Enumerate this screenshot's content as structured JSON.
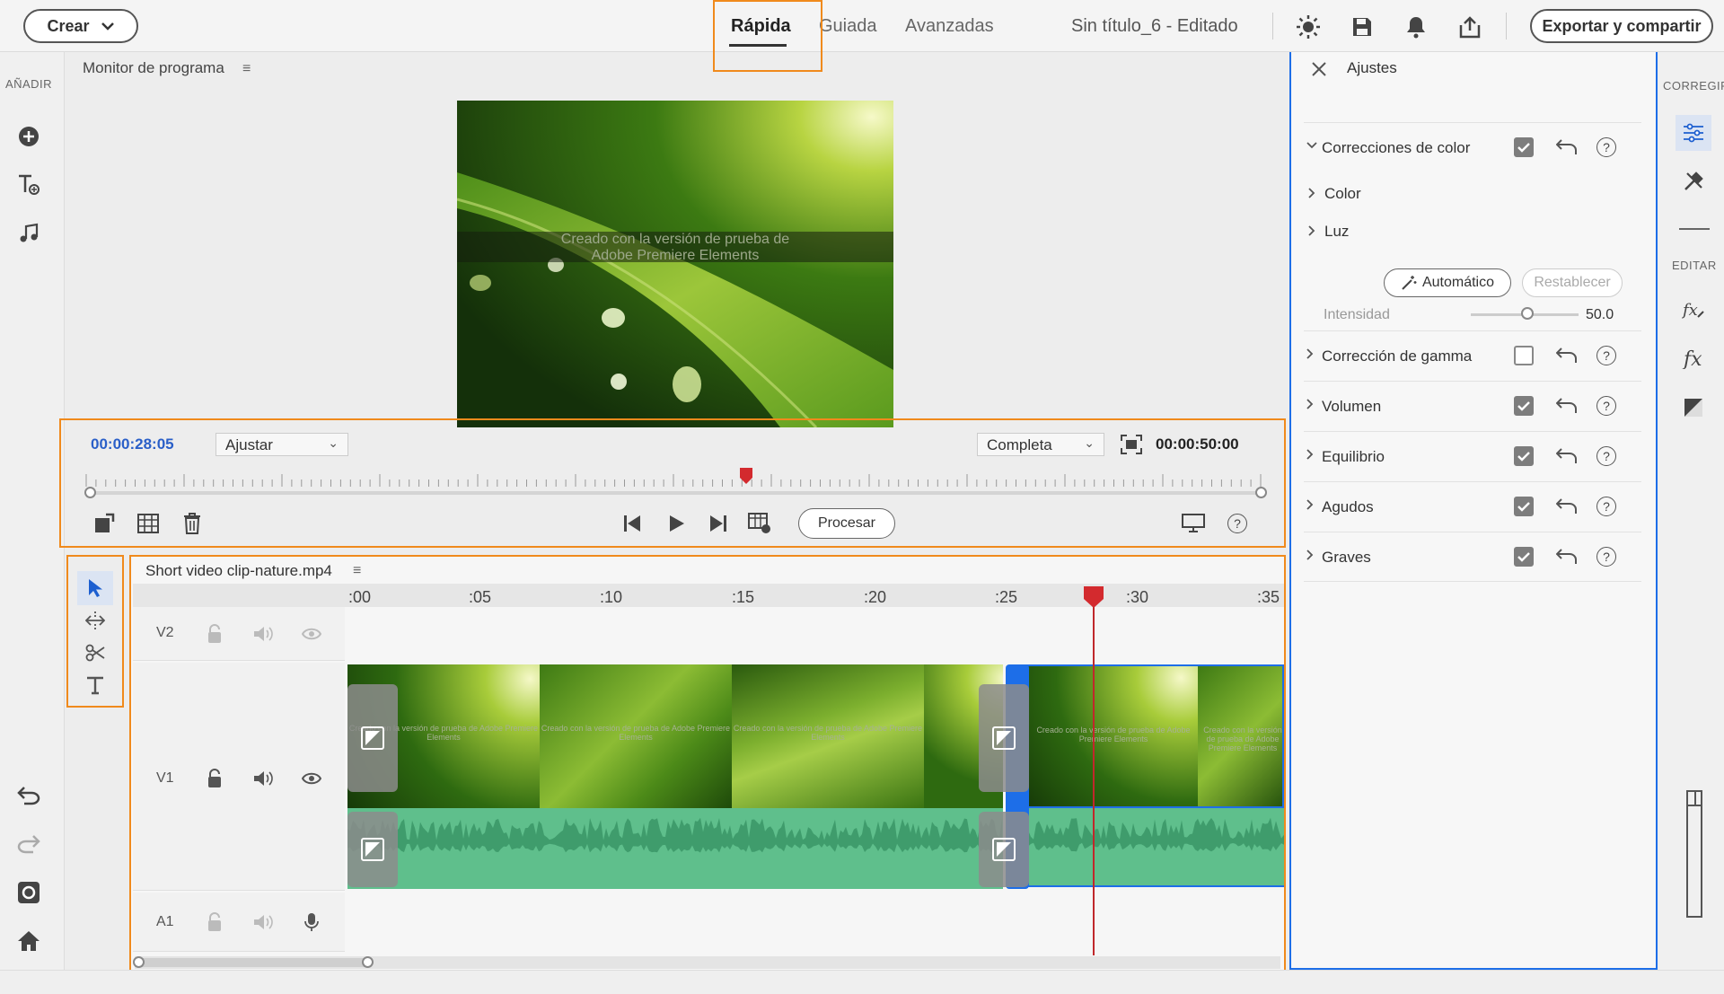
{
  "topbar": {
    "crear_label": "Crear",
    "tabs": [
      {
        "label": "Rápida",
        "active": true
      },
      {
        "label": "Guiada",
        "active": false
      },
      {
        "label": "Avanzadas",
        "active": false
      }
    ],
    "doc_title": "Sin título_6  - Editado",
    "export_label": "Exportar y compartir",
    "icons": [
      "brightness-icon",
      "save-icon",
      "notification-bell-icon",
      "share-upload-icon"
    ]
  },
  "leftbar": {
    "section_label": "AÑADIR",
    "icons": [
      "add-media-icon",
      "titles-icon",
      "music-icon",
      "undo-icon",
      "redo-icon",
      "organizer-icon",
      "home-icon"
    ]
  },
  "monitor": {
    "title": "Monitor de programa",
    "menu_glyph": "≡",
    "watermark_line1": "Creado con la versión de prueba de",
    "watermark_line2": "Adobe Premiere Elements",
    "current_timecode": "00:00:28:05",
    "fit_dropdown": "Ajustar",
    "quality_dropdown": "Completa",
    "total_timecode": "00:00:50:00",
    "playhead_fraction": 0.56,
    "procesar_label": "Procesar",
    "help_glyph": "?"
  },
  "timeline": {
    "title": "Short video clip-nature.mp4",
    "menu_glyph": "≡",
    "ruler_ticks": [
      ":00",
      ":05",
      ":10",
      ":15",
      ":20",
      ":25",
      ":30",
      ":35"
    ],
    "tracks": {
      "v2": "V2",
      "v1": "V1",
      "a1": "A1"
    },
    "clip_watermark": "Creado con la versión de prueba de Adobe Premiere Elements"
  },
  "adjust_panel": {
    "title": "Ajustes",
    "sections": [
      {
        "label": "Correcciones de color",
        "checked": true,
        "expanded": true
      },
      {
        "label": "Corrección de gamma",
        "checked": false
      },
      {
        "label": "Volumen",
        "checked": true
      },
      {
        "label": "Equilibrio",
        "checked": true
      },
      {
        "label": "Agudos",
        "checked": true
      },
      {
        "label": "Graves",
        "checked": true
      }
    ],
    "sub_color": "Color",
    "sub_luz": "Luz",
    "auto_label": "Automático",
    "reset_label": "Restablecer",
    "intensity_label": "Intensidad",
    "intensity_value": "50.0",
    "help_glyph": "?"
  },
  "farright": {
    "corregir_label": "CORREGIR",
    "editar_label": "EDITAR"
  },
  "colors": {
    "accent_highlight": "#f08a1c",
    "selection_blue": "#1d6ee8",
    "playhead_red": "#c0282b",
    "audio_green": "#5fbf8c",
    "timecode_blue": "#2a5fc8"
  }
}
